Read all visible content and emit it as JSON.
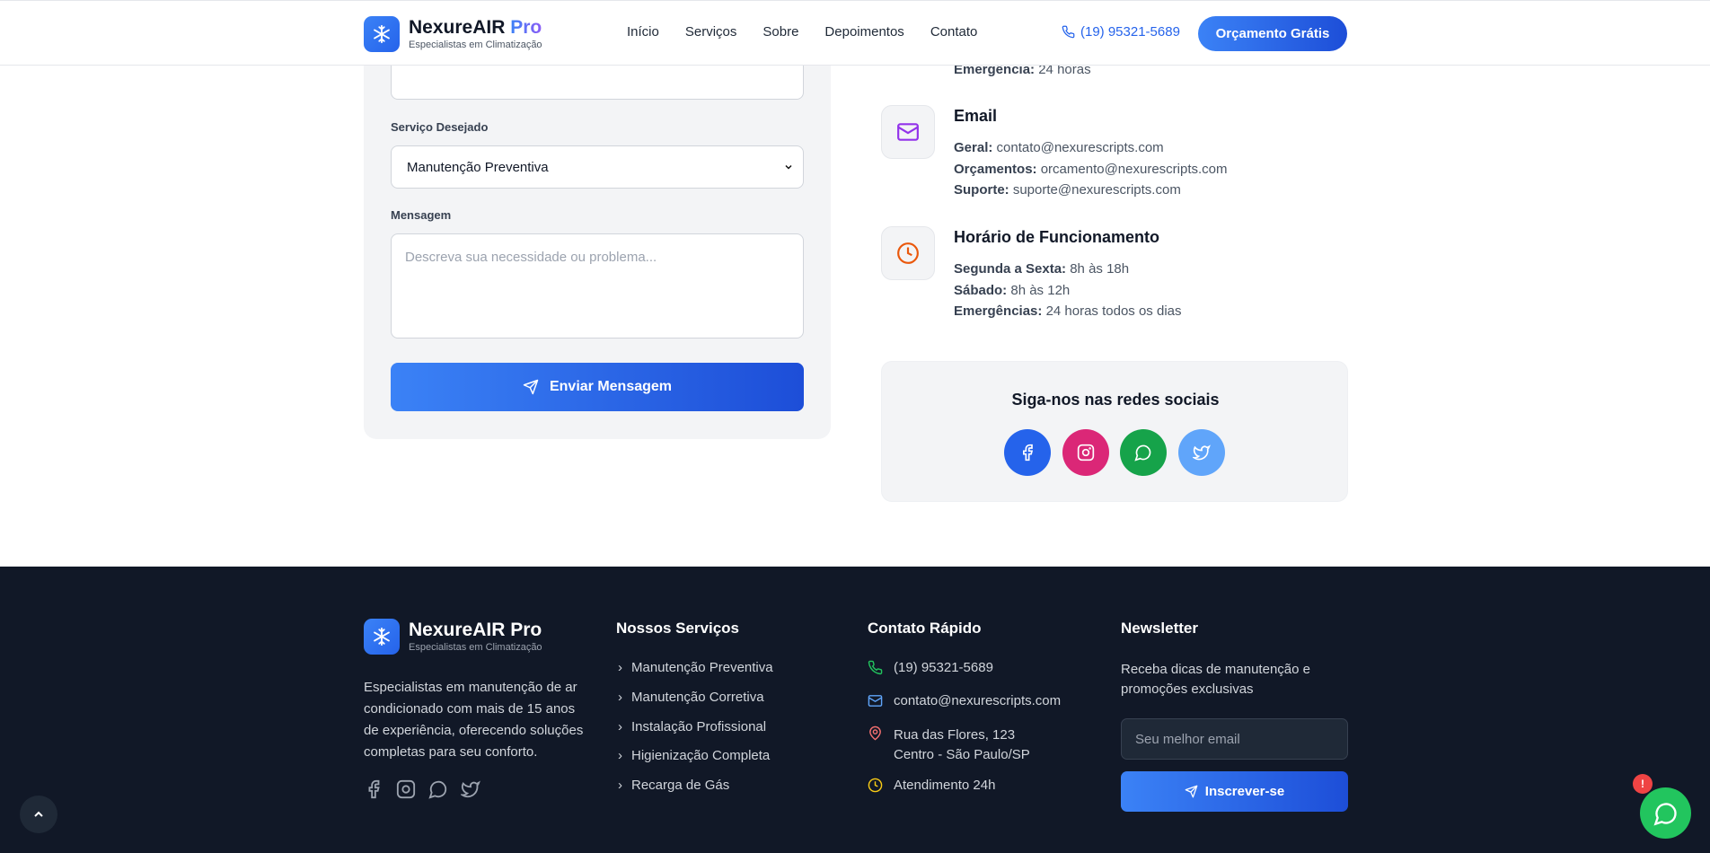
{
  "header": {
    "brand": "NexureAIR",
    "brand_suffix": "Pro",
    "tagline": "Especialistas em Climatização",
    "nav": [
      "Início",
      "Serviços",
      "Sobre",
      "Depoimentos",
      "Contato"
    ],
    "phone": "(19) 95321-5689",
    "cta": "Orçamento Grátis"
  },
  "form": {
    "service_label": "Serviço Desejado",
    "service_value": "Manutenção Preventiva",
    "message_label": "Mensagem",
    "message_placeholder": "Descreva sua necessidade ou problema...",
    "submit": "Enviar Mensagem"
  },
  "contact": {
    "emergency_partial_label": "Emergência:",
    "emergency_partial_value": "24 horas",
    "email_title": "Email",
    "email_lines": [
      {
        "label": "Geral:",
        "value": "contato@nexurescripts.com"
      },
      {
        "label": "Orçamentos:",
        "value": "orcamento@nexurescripts.com"
      },
      {
        "label": "Suporte:",
        "value": "suporte@nexurescripts.com"
      }
    ],
    "hours_title": "Horário de Funcionamento",
    "hours_lines": [
      {
        "label": "Segunda a Sexta:",
        "value": "8h às 18h"
      },
      {
        "label": "Sábado:",
        "value": "8h às 12h"
      },
      {
        "label": "Emergências:",
        "value": "24 horas todos os dias"
      }
    ],
    "social_title": "Siga-nos nas redes sociais"
  },
  "footer": {
    "brand": "NexureAIR Pro",
    "tagline": "Especialistas em Climatização",
    "description": "Especialistas em manutenção de ar condicionado com mais de 15 anos de experiência, oferecendo soluções completas para seu conforto.",
    "services_title": "Nossos Serviços",
    "services": [
      "Manutenção Preventiva",
      "Manutenção Corretiva",
      "Instalação Profissional",
      "Higienização Completa",
      "Recarga de Gás"
    ],
    "contact_title": "Contato Rápido",
    "contact_phone": "(19) 95321-5689",
    "contact_email": "contato@nexurescripts.com",
    "contact_address_1": "Rua das Flores, 123",
    "contact_address_2": "Centro - São Paulo/SP",
    "contact_hours": "Atendimento 24h",
    "newsletter_title": "Newsletter",
    "newsletter_desc": "Receba dicas de manutenção e promoções exclusivas",
    "newsletter_placeholder": "Seu melhor email",
    "newsletter_button": "Inscrever-se"
  },
  "whatsapp_badge": "!",
  "colors": {
    "primary": "#3b82f6",
    "primary_dark": "#1d4ed8",
    "footer_bg": "#111827",
    "facebook": "#2563eb",
    "instagram": "#db2777",
    "whatsapp": "#16a34a",
    "twitter": "#60a5fa"
  }
}
